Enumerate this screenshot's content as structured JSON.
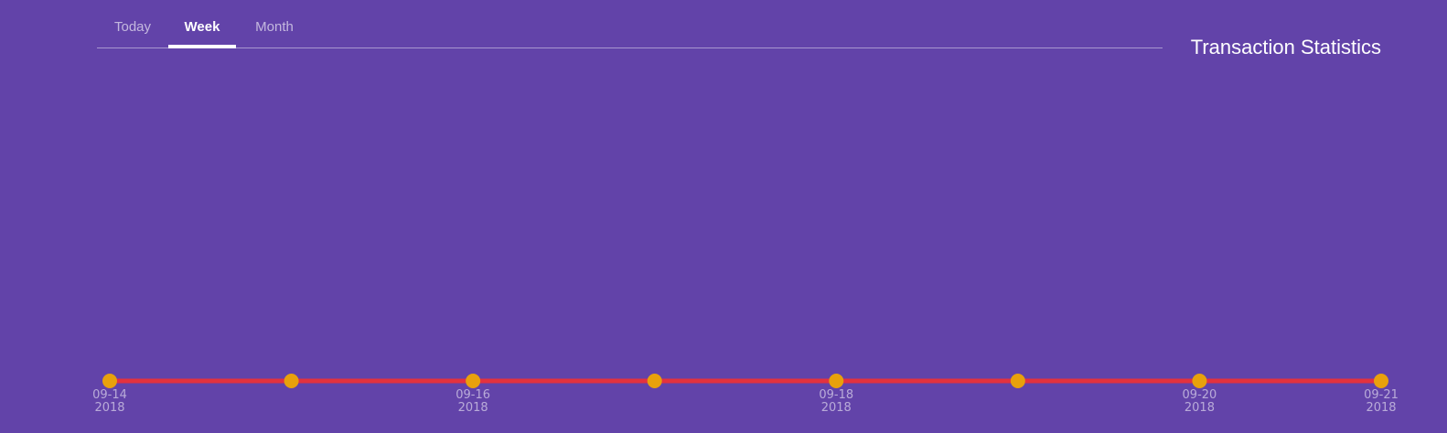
{
  "header": {
    "title": "Transaction Statistics",
    "tabs": [
      {
        "label": "Today",
        "active": false
      },
      {
        "label": "Week",
        "active": true
      },
      {
        "label": "Month",
        "active": false
      }
    ]
  },
  "colors": {
    "background": "#6243a9",
    "line": "#e3323e",
    "marker": "#e8a10c",
    "tick_label": "#b9a9d9"
  },
  "chart_data": {
    "type": "line",
    "x": [
      "2018-09-14",
      "2018-09-15",
      "2018-09-16",
      "2018-09-17",
      "2018-09-18",
      "2018-09-19",
      "2018-09-20",
      "2018-09-21"
    ],
    "tick_labels": [
      {
        "index": 0,
        "line1": "09-14",
        "line2": "2018"
      },
      {
        "index": 2,
        "line1": "09-16",
        "line2": "2018"
      },
      {
        "index": 4,
        "line1": "09-18",
        "line2": "2018"
      },
      {
        "index": 6,
        "line1": "09-20",
        "line2": "2018"
      },
      {
        "index": 7,
        "line1": "09-21",
        "line2": "2018"
      }
    ],
    "series": [
      {
        "values": [
          0,
          0,
          0,
          0,
          0,
          0,
          0,
          0
        ]
      }
    ],
    "ylim": [
      0,
      1
    ],
    "grid": false,
    "legend": "none",
    "title": "Transaction Statistics",
    "xlabel": "",
    "ylabel": ""
  }
}
